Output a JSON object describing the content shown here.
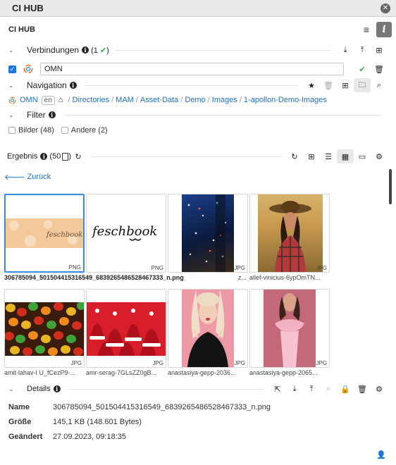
{
  "window": {
    "title": "CI HUB"
  },
  "app": {
    "title": "CI HUB"
  },
  "connections": {
    "label": "Verbindungen",
    "count": "(1",
    "close_paren": ")",
    "item": {
      "value": "OMN"
    }
  },
  "navigation": {
    "label": "Navigation",
    "source": "OMN",
    "lang": "en",
    "breadcrumb": [
      "Directories",
      "MAM",
      "Asset-Data",
      "Demo",
      "Images",
      "1-apollon-Demo-Images"
    ]
  },
  "filter": {
    "label": "Filter",
    "options": [
      {
        "label": "Bilder (48)",
        "checked": false
      },
      {
        "label": "Andere (2)",
        "checked": false
      }
    ]
  },
  "results": {
    "label": "Ergebnis",
    "count": "(50",
    "back_label": "Zurück",
    "items": [
      {
        "name": "306785094_501504415316549_6839265486528467333_n.png",
        "type": "PNG"
      },
      {
        "name": "",
        "type": "PNG"
      },
      {
        "name": "z...",
        "type": "JPG"
      },
      {
        "name": "allef-vinicius-6ypOmTN...",
        "type": "JPG"
      },
      {
        "name": "amit-lahav-I U_fCezP9-...",
        "type": "JPG"
      },
      {
        "name": "amr-serag-7GLsZZ0gB...",
        "type": "JPG"
      },
      {
        "name": "anastasiya-gepp-2036...",
        "type": "JPG"
      },
      {
        "name": "anastasiya-gepp-2065...",
        "type": "JPG"
      }
    ]
  },
  "details": {
    "label": "Details",
    "rows": [
      {
        "key": "Name",
        "value": "306785094_501504415316549_6839265486528467333_n.png"
      },
      {
        "key": "Größe",
        "value": "145,1 KB (148.601 Bytes)"
      },
      {
        "key": "Geändert",
        "value": "27.09.2023, 09:18:35"
      }
    ]
  },
  "icons": {
    "close": "close-icon",
    "menu": "menu-icon",
    "info": "info-icon",
    "download": "download-icon",
    "upload": "upload-icon",
    "add": "add-icon",
    "check": "check-icon",
    "trash": "trash-icon",
    "star": "star-icon",
    "folder": "folder-icon",
    "search": "search-icon",
    "refresh": "refresh-icon",
    "list": "list-view-icon",
    "grid": "grid-view-icon",
    "card": "card-view-icon",
    "settings": "gear-icon",
    "user": "user-icon"
  },
  "colors": {
    "accent": "#1a6fc4",
    "selection": "#3b8be0",
    "success": "#2fa84f"
  }
}
